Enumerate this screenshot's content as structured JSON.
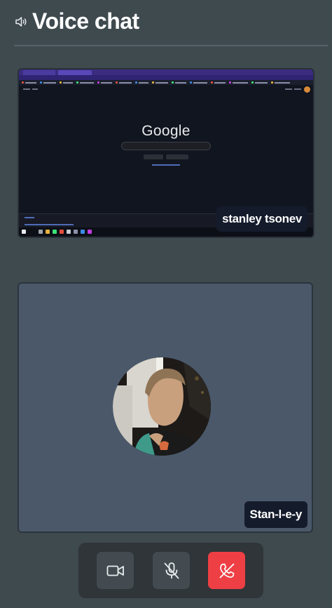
{
  "header": {
    "title": "Voice chat",
    "icon": "speaker-icon"
  },
  "screen_share": {
    "participant": "stanley tsonev",
    "content": {
      "logo": "Google"
    }
  },
  "camera_tile": {
    "participant": "Stan-l-e-y",
    "avatar": "avatar-photo"
  },
  "controls": {
    "camera": {
      "icon": "video-camera-icon"
    },
    "microphone": {
      "icon": "mic-muted-icon"
    },
    "hangup": {
      "icon": "phone-hangup-icon",
      "color": "#ee3f45"
    }
  },
  "colors": {
    "background": "#3f4a4f",
    "tile": "#4a586a",
    "name_tag": "#141b2b",
    "control_bar": "#2f3538",
    "control_button": "#434b50",
    "danger": "#ee3f45"
  }
}
